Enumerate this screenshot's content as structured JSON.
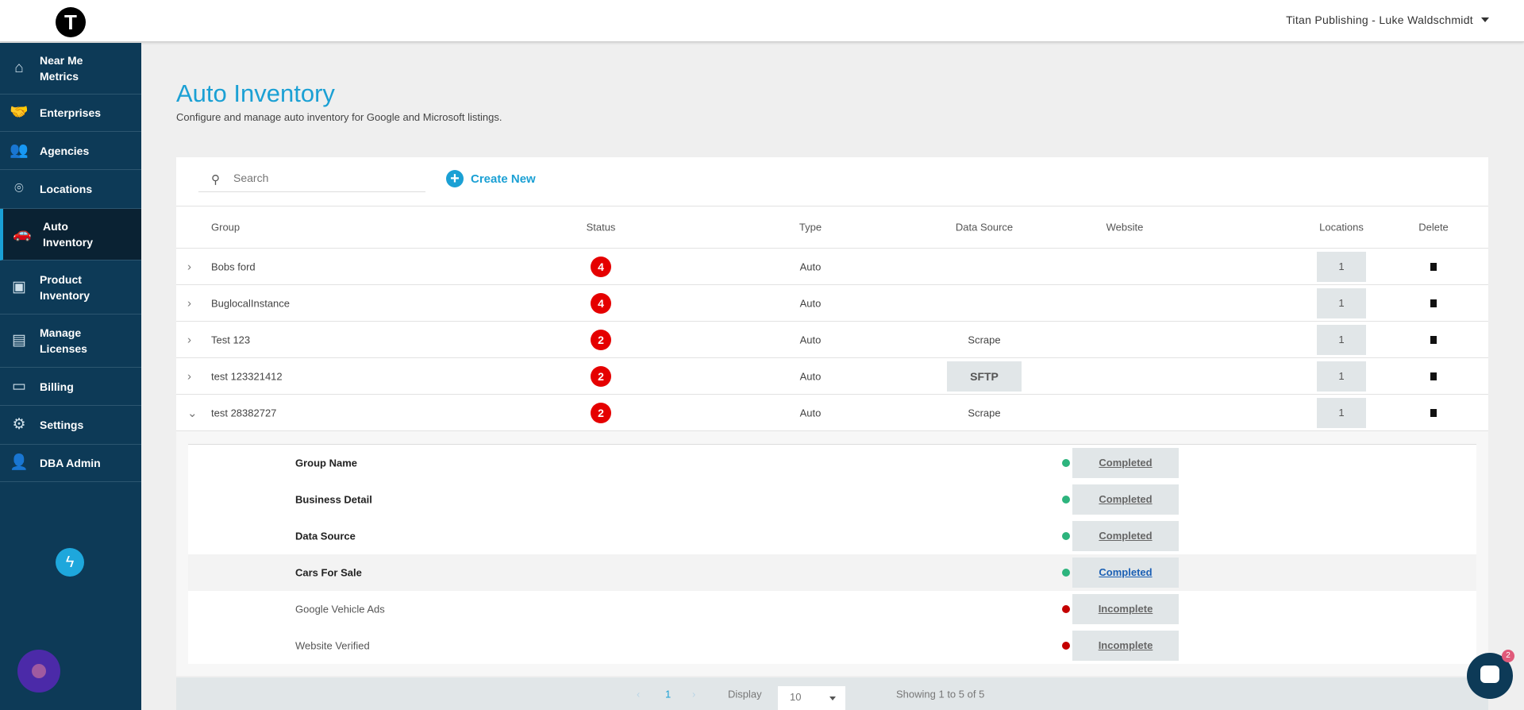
{
  "header": {
    "logo": "T",
    "user": "Titan Publishing - Luke Waldschmidt"
  },
  "sidebar": {
    "items": [
      {
        "label": "Near Me Metrics",
        "icon": "home-icon"
      },
      {
        "label": "Enterprises",
        "icon": "handshake-icon"
      },
      {
        "label": "Agencies",
        "icon": "people-icon"
      },
      {
        "label": "Locations",
        "icon": "map-pin-icon"
      },
      {
        "label": "Auto Inventory",
        "icon": "car-icon",
        "active": true
      },
      {
        "label": "Product Inventory",
        "icon": "box-icon"
      },
      {
        "label": "Manage Licenses",
        "icon": "license-icon"
      },
      {
        "label": "Billing",
        "icon": "billing-icon"
      },
      {
        "label": "Settings",
        "icon": "gear-icon"
      },
      {
        "label": "DBA Admin",
        "icon": "admin-icon"
      }
    ]
  },
  "page": {
    "title": "Auto Inventory",
    "subtitle": "Configure and manage auto inventory for Google and Microsoft listings."
  },
  "toolbar": {
    "search_placeholder": "Search",
    "create_label": "Create New"
  },
  "table": {
    "columns": [
      "Group",
      "Status",
      "Type",
      "Data Source",
      "Website",
      "Locations",
      "Delete"
    ],
    "rows": [
      {
        "group": "Bobs ford",
        "status": "4",
        "type": "Auto",
        "source": "",
        "website": "",
        "locations": "1"
      },
      {
        "group": "BuglocalInstance",
        "status": "4",
        "type": "Auto",
        "source": "",
        "website": "",
        "locations": "1"
      },
      {
        "group": "Test 123",
        "status": "2",
        "type": "Auto",
        "source": "Scrape",
        "website": "",
        "locations": "1"
      },
      {
        "group": "test 123321412",
        "status": "2",
        "type": "Auto",
        "source": "SFTP",
        "website": "",
        "locations": "1"
      },
      {
        "group": "test 28382727",
        "status": "2",
        "type": "Auto",
        "source": "Scrape",
        "website": "",
        "locations": "1",
        "expanded": true
      }
    ]
  },
  "details": [
    {
      "label": "Group Name",
      "state": "Completed",
      "color": "#2db47d"
    },
    {
      "label": "Business Detail",
      "state": "Completed",
      "color": "#2db47d"
    },
    {
      "label": "Data Source",
      "state": "Completed",
      "color": "#2db47d"
    },
    {
      "label": "Cars For Sale",
      "state": "Completed",
      "color": "#2db47d"
    },
    {
      "label": "Google Vehicle Ads",
      "state": "Incomplete",
      "color": "#c40000"
    },
    {
      "label": "Website Verified",
      "state": "Incomplete",
      "color": "#c40000"
    }
  ],
  "footer": {
    "page": "1",
    "display_label": "Display",
    "display_value": "10",
    "showing": "Showing 1 to 5 of 5"
  },
  "chat": {
    "count": "2"
  }
}
